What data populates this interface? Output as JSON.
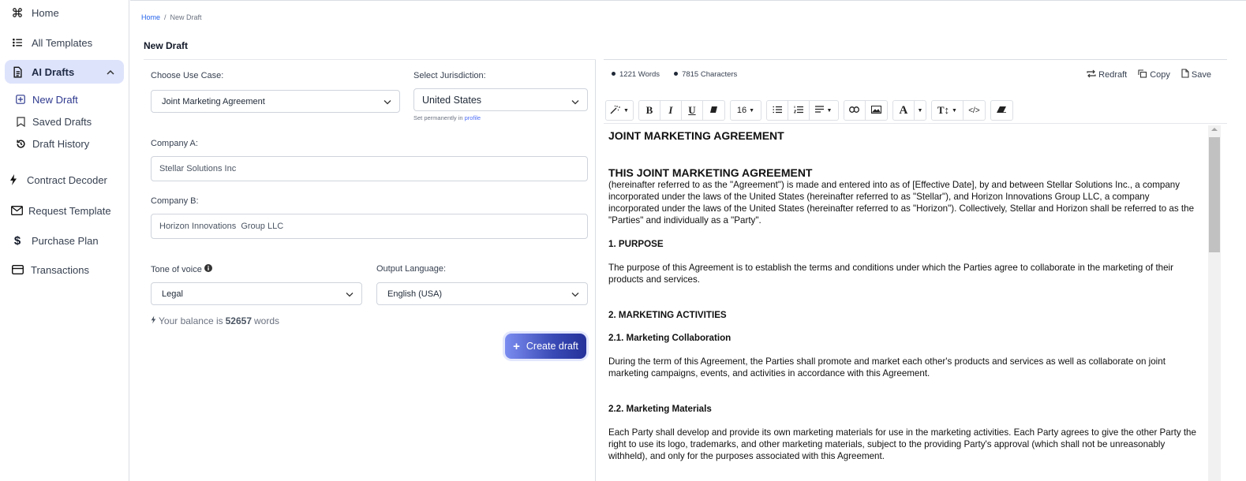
{
  "sidebar": {
    "items": [
      {
        "label": "Home",
        "icon": "command-icon"
      },
      {
        "label": "All Templates",
        "icon": "list-icon"
      },
      {
        "label": "AI Drafts",
        "icon": "document-icon",
        "expanded": true
      },
      {
        "label": "Contract Decoder",
        "icon": "bolt-icon"
      },
      {
        "label": "Request Template",
        "icon": "mail-icon"
      },
      {
        "label": "Purchase Plan",
        "icon": "dollar-icon"
      },
      {
        "label": "Transactions",
        "icon": "card-icon"
      }
    ],
    "sub_items": [
      {
        "label": "New Draft",
        "icon": "plus-square-icon"
      },
      {
        "label": "Saved Drafts",
        "icon": "bookmark-icon"
      },
      {
        "label": "Draft History",
        "icon": "history-icon"
      }
    ]
  },
  "breadcrumb": {
    "home": "Home",
    "separator": "/",
    "current": "New Draft"
  },
  "page_title": "New Draft",
  "form": {
    "use_case_label": "Choose Use Case:",
    "use_case_value": "Joint Marketing Agreement",
    "jurisdiction_label": "Select Jurisdiction:",
    "jurisdiction_value": "United States",
    "jurisdiction_hint": "Set permanently in",
    "jurisdiction_hint_link": "profile",
    "company_a_label": "Company A:",
    "company_a_value": "Stellar Solutions Inc",
    "company_b_label": "Company B:",
    "company_b_value": "Horizon Innovations  Group LLC",
    "tone_label": "Tone of voice",
    "tone_value": "Legal",
    "language_label": "Output Language:",
    "language_value": "English (USA)",
    "balance_prefix": "Your balance is",
    "balance_value": "52657",
    "balance_suffix": "words",
    "create_button": "Create draft"
  },
  "editor": {
    "words": "1221 Words",
    "characters": "7815 Characters",
    "actions": {
      "redraft": "Redraft",
      "copy": "Copy",
      "save": "Save"
    },
    "toolbar": {
      "font_size": "16"
    },
    "document": {
      "title": "JOINT MARKETING AGREEMENT",
      "subtitle": "THIS JOINT MARKETING AGREEMENT",
      "intro": "(hereinafter referred to as the \"Agreement\") is made and entered into as of [Effective Date], by and between Stellar Solutions Inc., a company incorporated under the laws of the United States (hereinafter referred to as \"Stellar\"), and Horizon Innovations Group LLC, a company incorporated under the laws of the United States (hereinafter referred to as \"Horizon\"). Collectively, Stellar and Horizon shall be referred to as the \"Parties\" and individually as a \"Party\".",
      "s1_heading": "1. PURPOSE",
      "s1_body": "The purpose of this Agreement is to establish the terms and conditions under which the Parties agree to collaborate in the marketing of their products and services.",
      "s2_heading": "2. MARKETING ACTIVITIES",
      "s21_heading": "2.1. Marketing Collaboration",
      "s21_body": "During the term of this Agreement, the Parties shall promote and market each other's products and services as well as collaborate on joint marketing campaigns, events, and activities in accordance with this Agreement.",
      "s22_heading": "2.2. Marketing Materials",
      "s22_body": "Each Party shall develop and provide its own marketing materials for use in the marketing activities. Each Party agrees to give the other Party the right to use its logo, trademarks, and other marketing materials, subject to the providing Party's approval (which shall not be unreasonably withheld), and only for the purposes associated with this Agreement."
    }
  },
  "colors": {
    "accent": "#3949b5",
    "active_nav_bg": "#dde3fb",
    "link": "#2563eb"
  }
}
